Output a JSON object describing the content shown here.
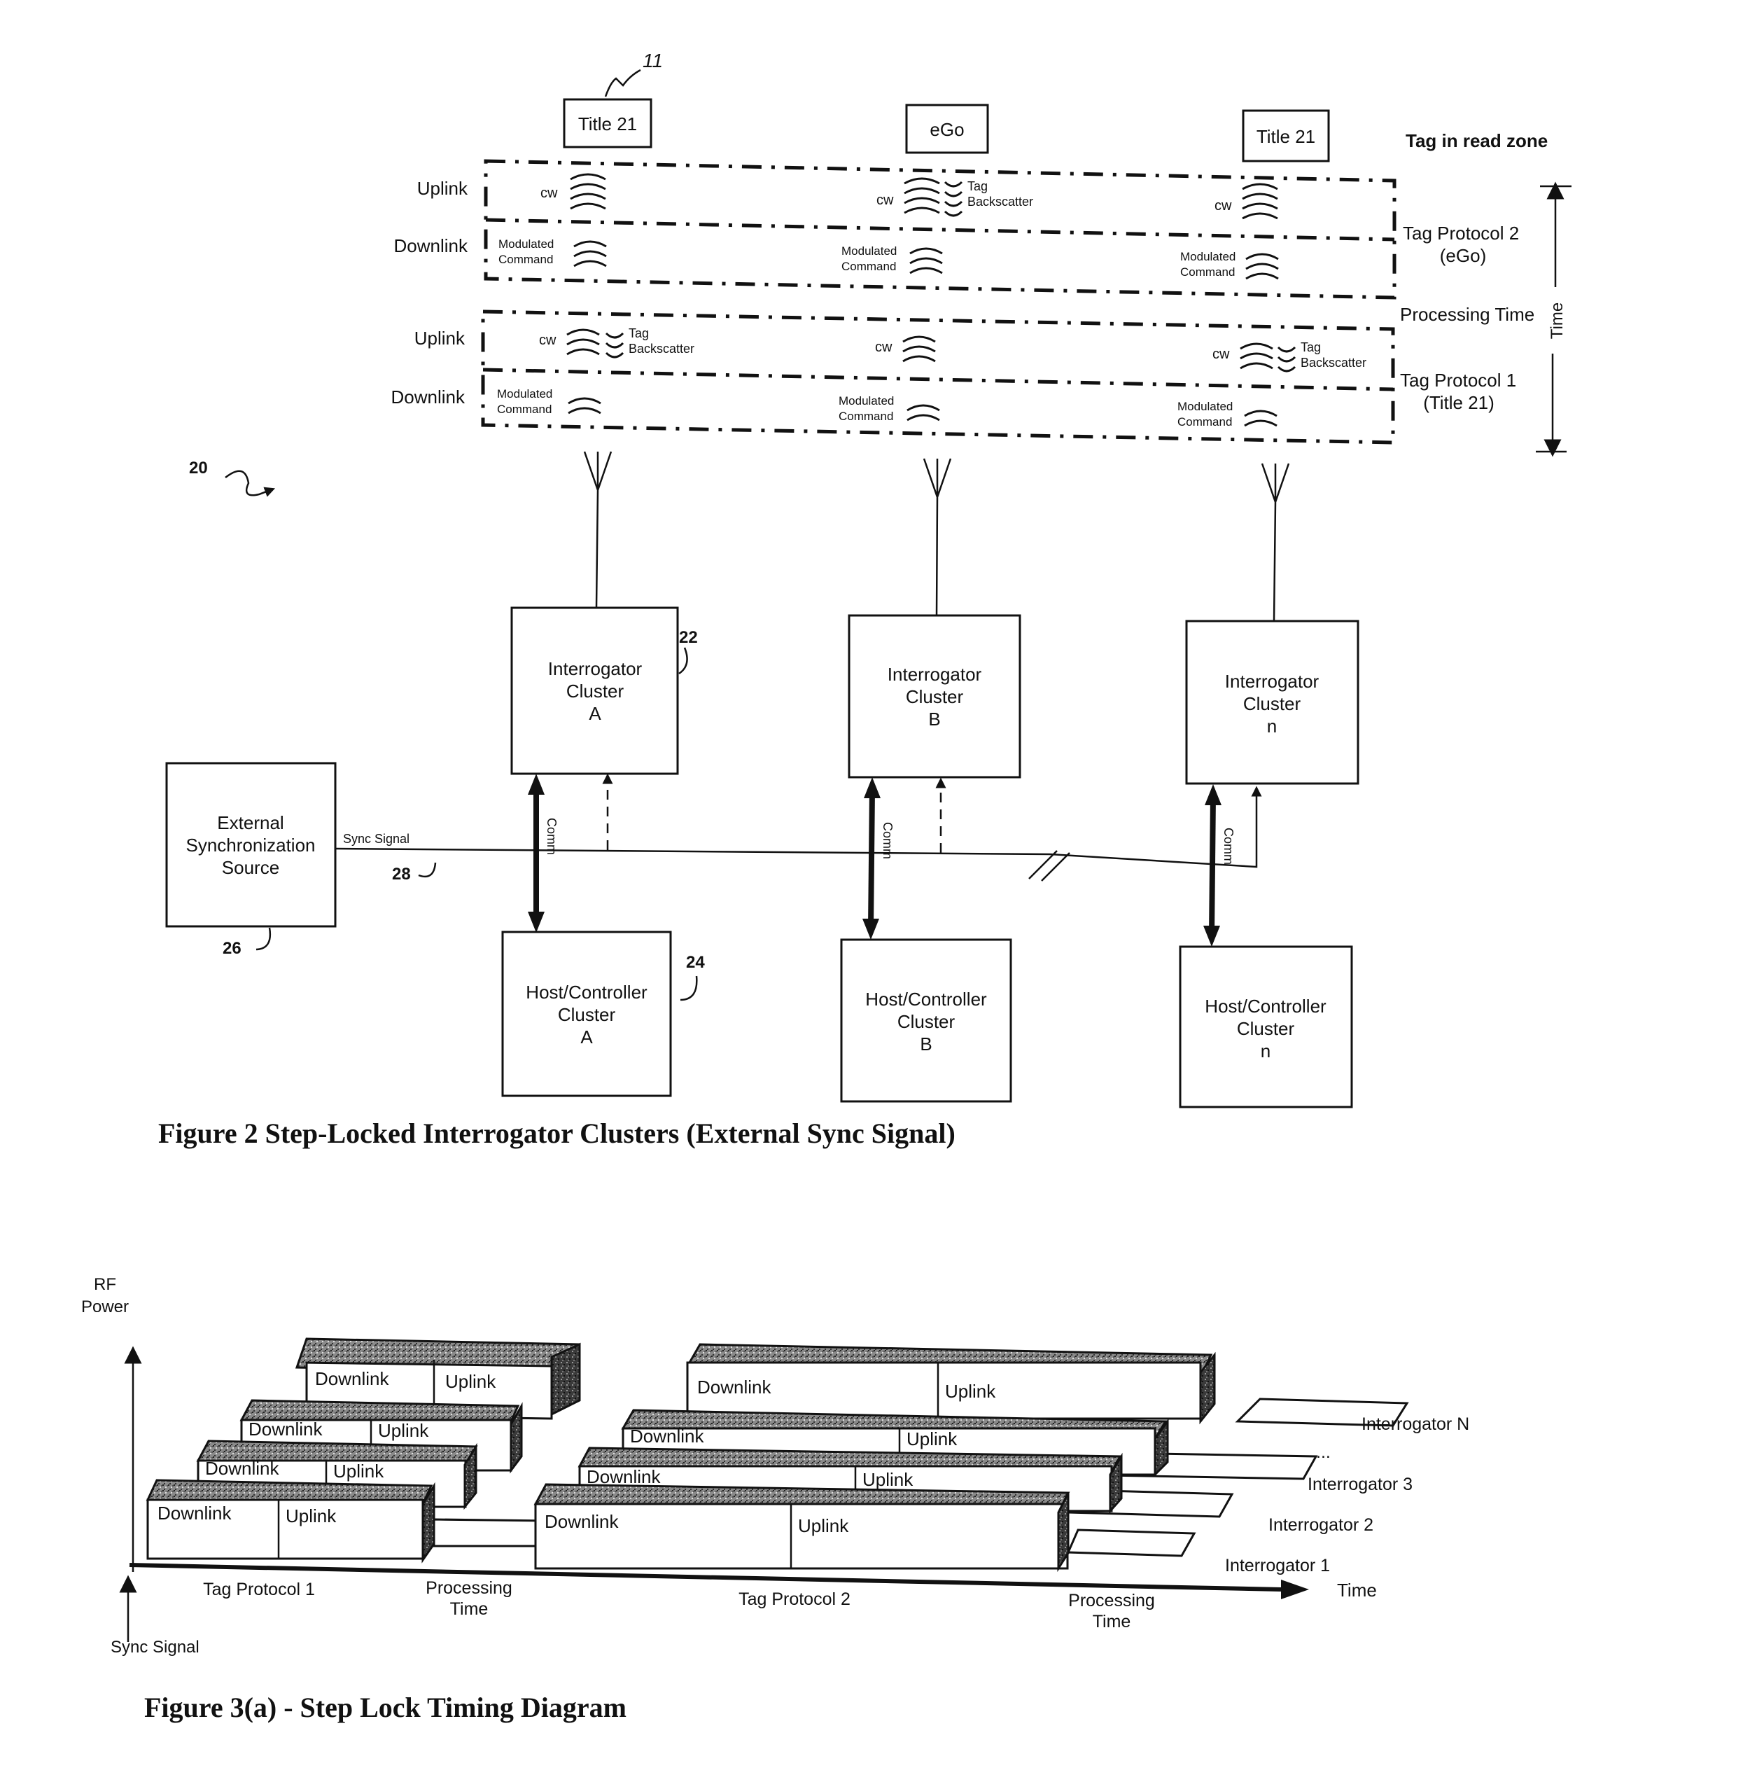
{
  "figure2": {
    "reference_numbers": {
      "tag": "11",
      "system": "20",
      "interrogator": "22",
      "host": "24",
      "sync_source": "26",
      "sync_line": "28"
    },
    "tags": [
      "Title 21",
      "eGo",
      "Title 21"
    ],
    "tag_zone_label": "Tag in read zone",
    "row_labels": {
      "uplink": "Uplink",
      "downlink": "Downlink"
    },
    "signal_labels": {
      "cw": "cw",
      "tag": "Tag",
      "backscatter": "Backscatter",
      "modulated": "Modulated",
      "command": "Command"
    },
    "right_labels": {
      "protocol2_line1": "Tag Protocol 2",
      "protocol2_line2": "(eGo)",
      "processing": "Processing Time",
      "protocol1_line1": "Tag Protocol 1",
      "protocol1_line2": "(Title 21)",
      "time_axis": "Time"
    },
    "interrogators": [
      {
        "line1": "Interrogator",
        "line2": "Cluster",
        "line3": "A"
      },
      {
        "line1": "Interrogator",
        "line2": "Cluster",
        "line3": "B"
      },
      {
        "line1": "Interrogator",
        "line2": "Cluster",
        "line3": "n"
      }
    ],
    "hosts": [
      {
        "line1": "Host/Controller",
        "line2": "Cluster",
        "line3": "A"
      },
      {
        "line1": "Host/Controller",
        "line2": "Cluster",
        "line3": "B"
      },
      {
        "line1": "Host/Controller",
        "line2": "Cluster",
        "line3": "n"
      }
    ],
    "comm_label": "Comm",
    "sync_source": {
      "line1": "External",
      "line2": "Synchronization",
      "line3": "Source"
    },
    "sync_signal_label": "Sync Signal",
    "caption": "Figure 2 Step-Locked Interrogator Clusters (External Sync Signal)"
  },
  "figure3a": {
    "y_axis_label_line1": "RF",
    "y_axis_label_line2": "Power",
    "x_axis_label": "Time",
    "sync_label": "Sync Signal",
    "phase_labels": {
      "tag_protocol_1": "Tag Protocol 1",
      "processing_1_line1": "Processing",
      "processing_1_line2": "Time",
      "tag_protocol_2": "Tag Protocol 2",
      "processing_2_line1": "Processing",
      "processing_2_line2": "Time"
    },
    "block_labels": {
      "downlink": "Downlink",
      "uplink": "Uplink"
    },
    "interrogators": [
      "Interrogator 1",
      "Interrogator 2",
      "Interrogator 3",
      "Interrogator N"
    ],
    "ellipsis": "...",
    "caption": "Figure 3(a) - Step Lock Timing Diagram"
  }
}
